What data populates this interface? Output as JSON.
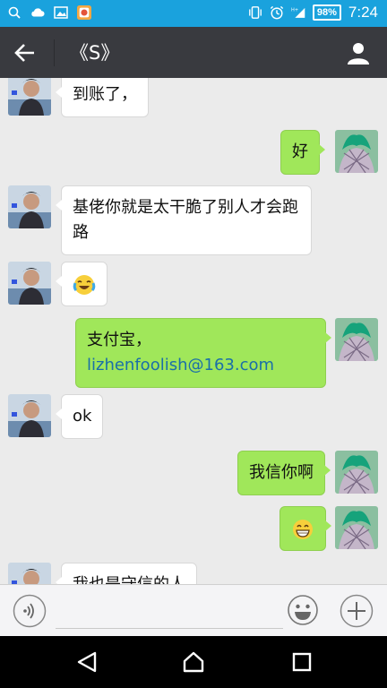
{
  "status_bar": {
    "battery": "98%",
    "time": "7:24",
    "bg_color": "#1aa2dd"
  },
  "header": {
    "title": "《S》",
    "bg_color": "#393a3f"
  },
  "messages": [
    {
      "side": "other",
      "text": "到账了，"
    },
    {
      "side": "me",
      "text": "好"
    },
    {
      "side": "other",
      "text": "基佬你就是太干脆了别人才会跑路"
    },
    {
      "side": "other",
      "emoji": "tears-of-joy"
    },
    {
      "side": "me",
      "line1": "支付宝，",
      "email": "lizhenfoolish@163.com"
    },
    {
      "side": "other",
      "text": "ok"
    },
    {
      "side": "me",
      "text": "我信你啊"
    },
    {
      "side": "me",
      "emoji": "grinning"
    },
    {
      "side": "other",
      "text": "我也是守信的人"
    }
  ],
  "input_bar": {
    "placeholder": "",
    "icons": [
      "voice-icon",
      "emoji-icon",
      "plus-icon"
    ]
  },
  "colors": {
    "my_bubble": "#a0e75a",
    "other_bubble": "#ffffff",
    "chat_bg": "#ebebeb"
  }
}
